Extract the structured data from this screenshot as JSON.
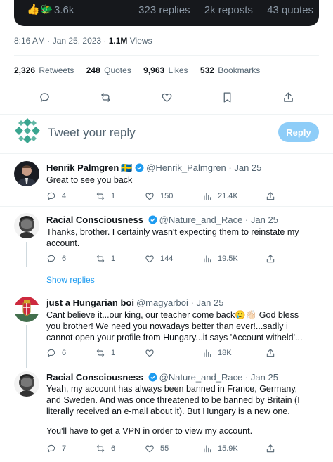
{
  "embed": {
    "emojis": "👍🐲",
    "likes": "3.6k",
    "replies": "323 replies",
    "reposts": "2k reposts",
    "quotes": "43 quotes"
  },
  "meta": {
    "time": "8:16 AM · Jan 25, 2023 · ",
    "views_num": "1.1M",
    "views_label": " Views"
  },
  "counts": {
    "retweets_num": "2,326",
    "retweets_label": "Retweets",
    "quotes_num": "248",
    "quotes_label": "Quotes",
    "likes_num": "9,963",
    "likes_label": "Likes",
    "bookmarks_num": "532",
    "bookmarks_label": "Bookmarks"
  },
  "reply_box": {
    "placeholder": "Tweet your reply",
    "button": "Reply"
  },
  "replies": [
    {
      "name": "Henrik Palmgren",
      "flag": "🇸🇪",
      "handle": "@Henrik_Palmgren",
      "sep": " · ",
      "date": "Jan 25",
      "text": "Great to see you back",
      "replies": "4",
      "retweets": "1",
      "likes": "150",
      "views": "21.4K"
    },
    {
      "name": "Racial Consciousness",
      "handle": "@Nature_and_Race",
      "sep": " · ",
      "date": "Jan 25",
      "text": "Thanks, brother. I certainly wasn't expecting them to reinstate my account.",
      "replies": "6",
      "retweets": "1",
      "likes": "144",
      "views": "19.5K"
    },
    {
      "show_replies": "Show replies"
    },
    {
      "name": "just a Hungarian boi",
      "handle": "@magyarboi",
      "sep": " · ",
      "date": "Jan 25",
      "text": "Cant believe it...our king, our teacher come back🥲👋🏻 God bless you brother! We need you nowadays better than ever!...sadly i cannot open your profile from Hungary...it says 'Account witheld'...",
      "replies": "6",
      "retweets": "1",
      "likes": "",
      "views": "18K"
    },
    {
      "name": "Racial Consciousness",
      "handle": "@Nature_and_Race",
      "sep": " · ",
      "date": "Jan 25",
      "text": "Yeah, my account has always been banned in France, Germany, and Sweden. And was once threatened to be banned by Britain (I literally received an e-mail about it). But Hungary is a new one.",
      "text2": "You'll have to get a VPN in order to view my account.",
      "replies": "7",
      "retweets": "6",
      "likes": "55",
      "views": "15.9K"
    }
  ],
  "colors": {
    "accent": "#1d9bf0",
    "reply_button": "#8ecdf8",
    "text_secondary": "#536471",
    "divider": "#eff3f4"
  }
}
